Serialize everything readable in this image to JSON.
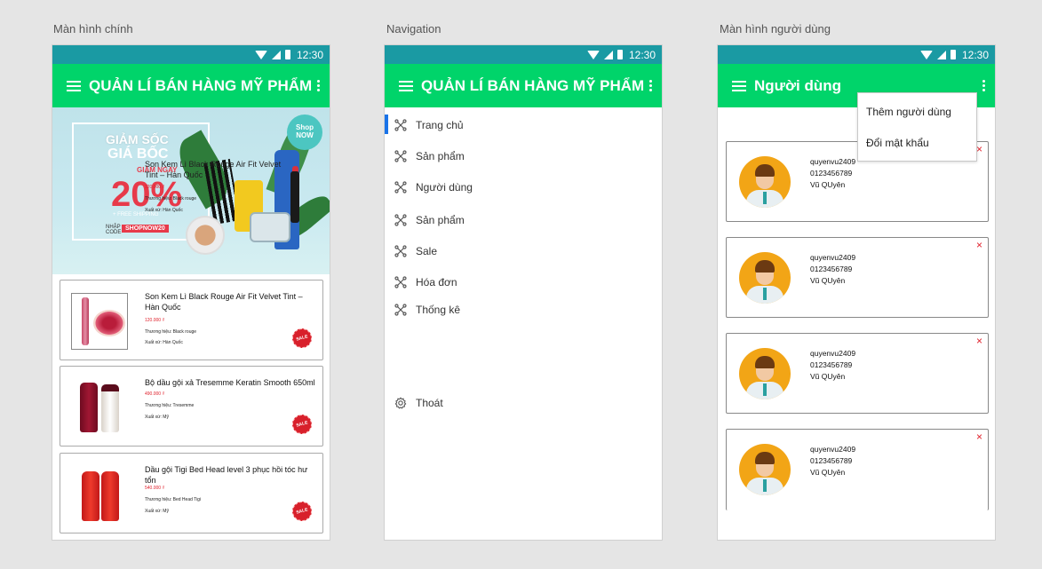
{
  "labels": {
    "main": "Màn hình chính",
    "nav": "Navigation",
    "user": "Màn hình người dùng"
  },
  "statusbar": {
    "time": "12:30"
  },
  "main_screen": {
    "title": "QUẢN LÍ BÁN HÀNG MỸ PHẨM",
    "banner": {
      "line1": "GIẢM SỐC",
      "line2": "GIÁ BỐC",
      "discount_label": "GIẢM NGAY",
      "discount": "20%",
      "shipping": "+ FREE SHIPPING",
      "code_label": "NHẬP CODE",
      "promo_code": "SHOPNOW20",
      "shop_now_1": "Shop",
      "shop_now_2": "NOW",
      "overlay_name": "Son Kem Lì Black Rouge Air Fit Velvet Tint – Hàn Quốc",
      "overlay_price": "120.000 ₫",
      "overlay_brand": "Thương hiệu: Black rouge",
      "overlay_origin": "Xuất xứ: Hàn Quốc"
    },
    "products": [
      {
        "name": "Son Kem Lì Black Rouge Air Fit Velvet Tint – Hàn Quốc",
        "price": "120.000 ₫",
        "brand": "Thương hiệu: Black rouge",
        "origin": "Xuất xứ: Hàn Quốc",
        "badge": "SALE"
      },
      {
        "name": "Bộ dầu gội xả Tresemme Keratin Smooth 650ml",
        "price": "490.000 ₫",
        "brand": "Thương hiệu: Tresemme",
        "origin": "Xuất xứ: Mỹ",
        "badge": "SALE"
      },
      {
        "name": "Dầu gội Tigi Bed Head level 3 phục hồi tóc hư tổn",
        "price": "540.000 ₫",
        "brand": "Thương hiệu: Bed Head Tigi",
        "origin": "Xuất xứ: Mỹ",
        "badge": "SALE"
      }
    ]
  },
  "nav_screen": {
    "title": "QUẢN LÍ BÁN HÀNG MỸ PHẨM",
    "items": [
      {
        "label": "Trang chủ",
        "icon": "network-icon"
      },
      {
        "label": "Sản phẩm",
        "icon": "network-icon"
      },
      {
        "label": "Người dùng",
        "icon": "network-icon"
      },
      {
        "label": "Sản phẩm",
        "icon": "network-icon"
      },
      {
        "label": "Sale",
        "icon": "network-icon"
      },
      {
        "label": "Hóa đơn",
        "icon": "network-icon"
      },
      {
        "label": "Thống kê",
        "icon": "network-icon"
      }
    ],
    "logout": {
      "label": "Thoát",
      "icon": "gear-icon"
    }
  },
  "user_screen": {
    "title": "Người dùng",
    "menu": [
      "Thêm người dùng",
      "Đổi mật khẩu"
    ],
    "users": [
      {
        "username": "quyenvu2409",
        "phone": "0123456789",
        "name": "Vũ QUyên"
      },
      {
        "username": "quyenvu2409",
        "phone": "0123456789",
        "name": "Vũ QUyên"
      },
      {
        "username": "quyenvu2409",
        "phone": "0123456789",
        "name": "Vũ QUyên"
      },
      {
        "username": "quyenvu2409",
        "phone": "0123456789",
        "name": "Vũ QUyên"
      }
    ],
    "close_glyph": "×"
  },
  "colors": {
    "statusbar": "#1a9aa3",
    "appbar": "#00d46a",
    "price": "#e0202b",
    "nav_active": "#1a73e8",
    "avatar_bg": "#f2a516"
  }
}
